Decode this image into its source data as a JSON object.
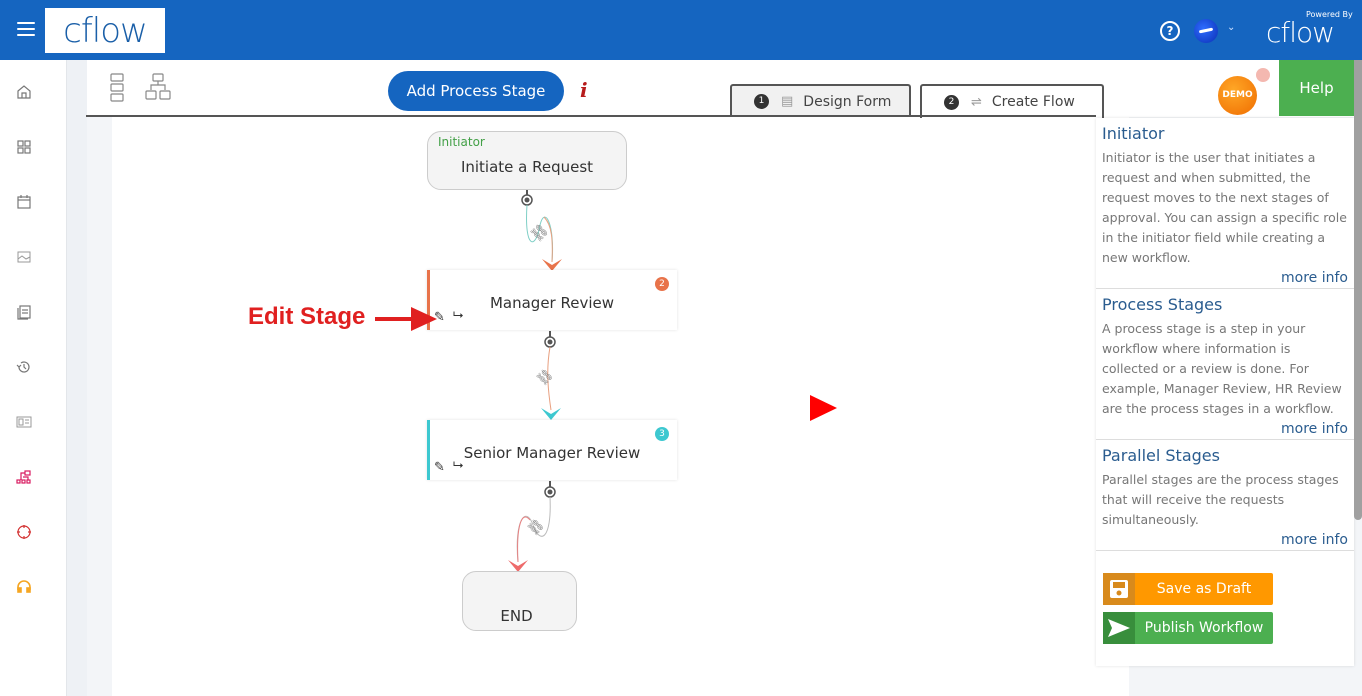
{
  "header": {
    "logo_text": "cflow",
    "help_icon_glyph": "?",
    "user_menu_caret": "⌄",
    "powered_by": "Powered By",
    "powered_logo": "cflow",
    "colors": {
      "topbar": "#1565c0"
    }
  },
  "sidebar": {
    "items": [
      {
        "icon": "home-icon"
      },
      {
        "icon": "apps-grid-icon"
      },
      {
        "icon": "calendar-icon"
      },
      {
        "icon": "reports-icon"
      },
      {
        "icon": "documents-icon"
      },
      {
        "icon": "history-icon"
      },
      {
        "icon": "dashboard-icon"
      },
      {
        "icon": "workflow-icon"
      },
      {
        "icon": "target-icon"
      },
      {
        "icon": "support-headset-icon"
      }
    ]
  },
  "toolbar": {
    "add_stage_label": "Add Process Stage",
    "info_glyph": "i",
    "tabs": [
      {
        "number": "1",
        "label": "Design Form",
        "active": false
      },
      {
        "number": "2",
        "label": "Create Flow",
        "active": true
      }
    ],
    "demo_badge": "DEMO",
    "help_label": "Help"
  },
  "flow": {
    "initiator": {
      "role": "Initiator",
      "title": "Initiate a Request"
    },
    "stages": [
      {
        "title": "Manager Review",
        "badge": "2",
        "color": "#e8734a"
      },
      {
        "title": "Senior Manager Review",
        "badge": "3",
        "color": "#3dc8d0"
      }
    ],
    "end": {
      "title": "END"
    },
    "annotation": "Edit Stage"
  },
  "help_panel": {
    "sections": [
      {
        "title": "Initiator",
        "text": "Initiator is the user that initiates a request and when submitted, the request moves to the next stages of approval. You can assign a specific role in the initiator field while creating a new workflow.",
        "more": "more info"
      },
      {
        "title": "Process Stages",
        "text": "A process stage is a step in your workflow where information is collected or a review is done. For example, Manager Review, HR Review are the process stages in a workflow.",
        "more": "more info"
      },
      {
        "title": "Parallel Stages",
        "text": "Parallel stages are the process stages that will receive the requests simultaneously.",
        "more": "more info"
      }
    ],
    "save_draft_label": "Save as Draft",
    "publish_label": "Publish Workflow",
    "colors": {
      "save": "#ff9800",
      "save_icon_bg": "#d88a1c",
      "publish": "#4caf50",
      "publish_icon_bg": "#388e3c"
    }
  }
}
